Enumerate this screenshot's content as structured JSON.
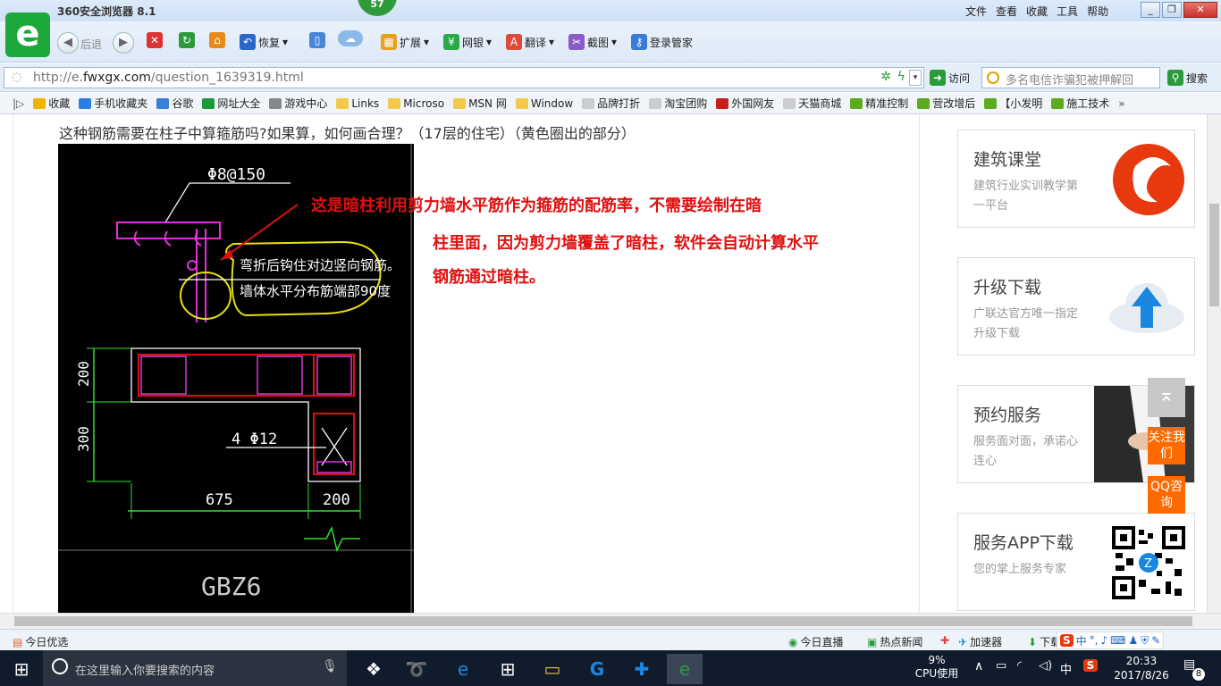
{
  "titlebar": {
    "app_title": "360安全浏览器 8.1",
    "badge": "57",
    "menus": [
      "文件",
      "查看",
      "收藏",
      "工具",
      "帮助"
    ]
  },
  "toolbar": {
    "back": "后退",
    "restore": "恢复",
    "extensions": "扩展",
    "banking": "网银",
    "translate": "翻译",
    "screenshot": "截图",
    "login_manager": "登录管家"
  },
  "address": {
    "url_prefix": "http://e.",
    "url_domain": "fwxgx.com",
    "url_path": "/question_1639319.html",
    "visit": "访问",
    "search_placeholder": "多名电信诈骗犯被押解回",
    "search_button": "搜索"
  },
  "bookmarks": [
    {
      "label": "收藏",
      "color": "#f0b400"
    },
    {
      "label": "手机收藏夹",
      "color": "#2a7de1"
    },
    {
      "label": "谷歌",
      "color": "#3b7fd8"
    },
    {
      "label": "网址大全",
      "color": "#1c9a3a"
    },
    {
      "label": "游戏中心",
      "color": "#888888"
    },
    {
      "label": "Links",
      "color": "#f3c94c"
    },
    {
      "label": "Microso",
      "color": "#f3c94c"
    },
    {
      "label": "MSN 网",
      "color": "#f3c94c"
    },
    {
      "label": "Window",
      "color": "#f3c94c"
    },
    {
      "label": "品牌打折",
      "color": "#cccccc"
    },
    {
      "label": "淘宝团购",
      "color": "#cccccc"
    },
    {
      "label": "外国网友",
      "color": "#c81e1e"
    },
    {
      "label": "天猫商城",
      "color": "#cccccc"
    },
    {
      "label": "精准控制",
      "color": "#5cab1e"
    },
    {
      "label": "营改增后",
      "color": "#5cab1e"
    },
    {
      "label": "【小发明",
      "color": "#5cab1e"
    },
    {
      "label": "施工技术",
      "color": "#5cab1e"
    }
  ],
  "page": {
    "question": "这种钢筋需要在柱子中算箍筋吗?如果算，如何画合理？（17层的住宅）（黄色圈出的部分）",
    "answer_lines": [
      "这是暗柱利用剪力墙水平筋作为箍筋的配筋率，不需要绘制在暗",
      "柱里面，因为剪力墙覆盖了暗柱，软件会自动计算水平",
      "钢筋通过暗柱。"
    ],
    "cad": {
      "rebar_label": "Φ8@150",
      "note_line1": "弯折后钩住对边竖向钢筋。",
      "note_line2": "墙体水平分布筋端部90度",
      "dim_200_top": "200",
      "dim_300": "300",
      "bar_label": "4 Φ12",
      "dim_675": "675",
      "dim_200_bottom": "200",
      "name": "GBZ6"
    }
  },
  "sidebar": {
    "cards": [
      {
        "title": "建筑课堂",
        "subtitle": "建筑行业实训教学第一平台"
      },
      {
        "title": "升级下载",
        "subtitle": "广联达官方唯一指定升级下载"
      },
      {
        "title": "预约服务",
        "subtitle": "服务面对面，承诺心连心"
      },
      {
        "title": "服务APP下载",
        "subtitle": "您的掌上服务专家"
      }
    ],
    "follow_us": "关注我们",
    "qq_consult": "QQ咨询"
  },
  "statusbar": {
    "today_picks": "今日优选",
    "live": "今日直播",
    "hot_news": "热点新闻",
    "accelerator": "加速器",
    "download": "下载",
    "ime": "中"
  },
  "taskbar": {
    "search_placeholder": "在这里输入你要搜索的内容",
    "cpu_percent": "9%",
    "cpu_label": "CPU使用",
    "ime": "中",
    "time": "20:33",
    "date": "2017/8/26",
    "notifications": "8"
  }
}
